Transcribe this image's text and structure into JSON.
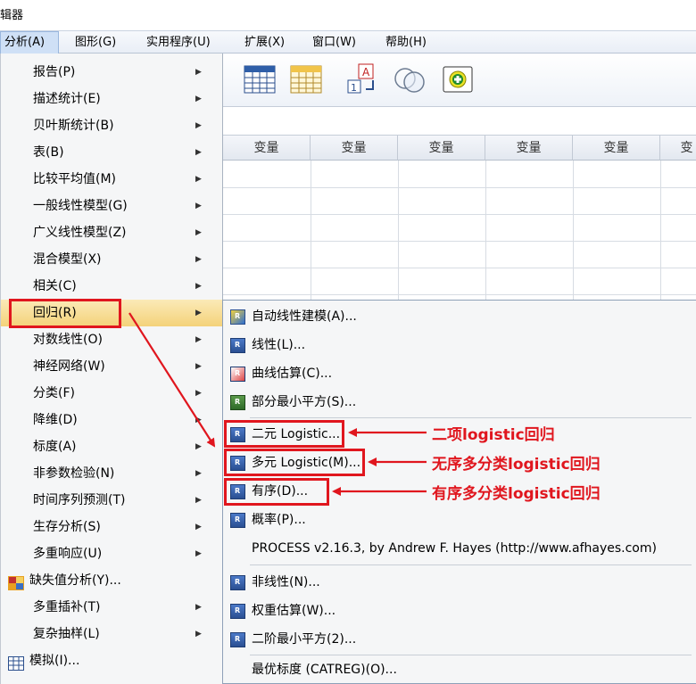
{
  "window": {
    "title_fragment": "辑器"
  },
  "menubar": {
    "items": [
      {
        "label": "分析(A)"
      },
      {
        "label": "图形(G)"
      },
      {
        "label": "实用程序(U)"
      },
      {
        "label": "扩展(X)"
      },
      {
        "label": "窗口(W)"
      },
      {
        "label": "帮助(H)"
      }
    ]
  },
  "grid": {
    "column_headers": [
      "变量",
      "变量",
      "变量",
      "变量",
      "变量",
      "变"
    ]
  },
  "analyze_menu": {
    "items": [
      {
        "label": "报告(P)"
      },
      {
        "label": "描述统计(E)"
      },
      {
        "label": "贝叶斯统计(B)"
      },
      {
        "label": "表(B)"
      },
      {
        "label": "比较平均值(M)"
      },
      {
        "label": "一般线性模型(G)"
      },
      {
        "label": "广义线性模型(Z)"
      },
      {
        "label": "混合模型(X)"
      },
      {
        "label": "相关(C)"
      },
      {
        "label": "回归(R)"
      },
      {
        "label": "对数线性(O)"
      },
      {
        "label": "神经网络(W)"
      },
      {
        "label": "分类(F)"
      },
      {
        "label": "降维(D)"
      },
      {
        "label": "标度(A)"
      },
      {
        "label": "非参数检验(N)"
      },
      {
        "label": "时间序列预测(T)"
      },
      {
        "label": "生存分析(S)"
      },
      {
        "label": "多重响应(U)"
      },
      {
        "label": "缺失值分析(Y)..."
      },
      {
        "label": "多重插补(T)"
      },
      {
        "label": "复杂抽样(L)"
      },
      {
        "label": "模拟(I)..."
      }
    ]
  },
  "regression_submenu": {
    "items": [
      {
        "label": "自动线性建模(A)..."
      },
      {
        "label": "线性(L)..."
      },
      {
        "label": "曲线估算(C)..."
      },
      {
        "label": "部分最小平方(S)..."
      },
      {
        "label": "二元 Logistic..."
      },
      {
        "label": "多元 Logistic(M)..."
      },
      {
        "label": "有序(D)..."
      },
      {
        "label": "概率(P)..."
      },
      {
        "label": "PROCESS v2.16.3, by Andrew F. Hayes (http://www.afhayes.com)"
      },
      {
        "label": "非线性(N)..."
      },
      {
        "label": "权重估算(W)..."
      },
      {
        "label": "二阶最小平方(2)..."
      },
      {
        "label": "最优标度 (CATREG)(O)..."
      }
    ]
  },
  "annotations": {
    "binary": "二项logistic回归",
    "multinomial": "无序多分类logistic回归",
    "ordinal": "有序多分类logistic回归"
  },
  "colors": {
    "annotation_red": "#e0161e",
    "highlight": "#f4d27a"
  }
}
